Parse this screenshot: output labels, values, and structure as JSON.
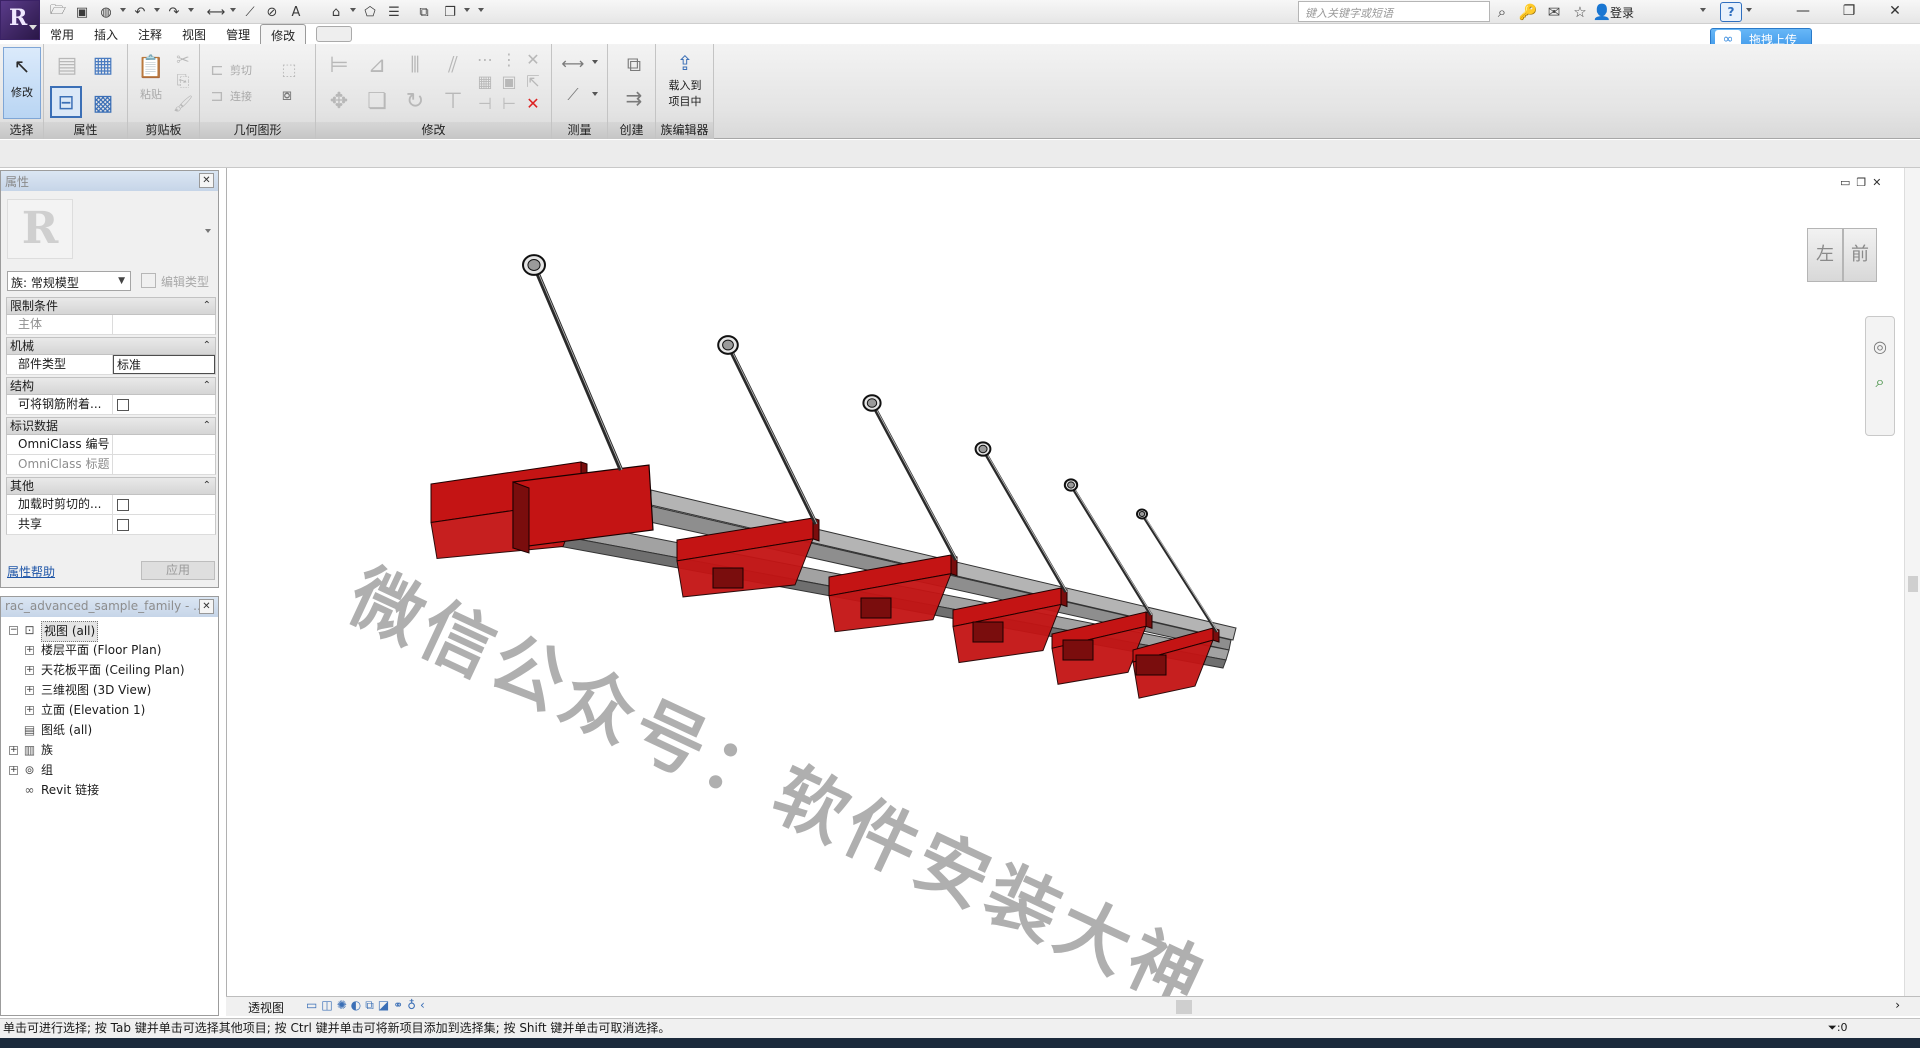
{
  "quick_access": {
    "icons": [
      "open-icon",
      "save-icon",
      "sync-icon",
      "undo-icon",
      "redo-icon",
      "measure-icon",
      "dimension-icon",
      "tag-icon",
      "text-icon",
      "3d-view-icon",
      "section-icon",
      "thin-lines-icon",
      "close-hidden-icon",
      "switch-windows-icon",
      "customize-icon"
    ]
  },
  "search": {
    "placeholder": "键入关键字或短语"
  },
  "user": {
    "login_label": "登录"
  },
  "tabs": [
    "常用",
    "插入",
    "注释",
    "视图",
    "管理",
    "修改"
  ],
  "active_tab": "修改",
  "ribbon": {
    "panels": {
      "select": "选择",
      "properties": "属性",
      "clipboard": "剪贴板",
      "geometry": "几何图形",
      "modify": "修改",
      "measure": "测量",
      "create": "创建",
      "family_editor": "族编辑器"
    },
    "buttons": {
      "modify": "修改",
      "paste": "粘贴",
      "cut": "剪切",
      "join": "连接",
      "load_line1": "载入到",
      "load_line2": "项目中"
    }
  },
  "baidu": {
    "upload_label": "拖拽上传"
  },
  "properties": {
    "title": "属性",
    "family_select": "族: 常规模型",
    "edit_type": "编辑类型",
    "groups": [
      {
        "name": "限制条件",
        "rows": [
          {
            "key": "主体",
            "value": "",
            "dim": true
          }
        ]
      },
      {
        "name": "机械",
        "rows": [
          {
            "key": "部件类型",
            "value": "标准",
            "boxed": true
          }
        ]
      },
      {
        "name": "结构",
        "rows": [
          {
            "key": "可将钢筋附着...",
            "checkbox": true
          }
        ]
      },
      {
        "name": "标识数据",
        "rows": [
          {
            "key": "OmniClass 编号",
            "value": ""
          },
          {
            "key": "OmniClass 标题",
            "value": "",
            "dim": true
          }
        ]
      },
      {
        "name": "其他",
        "rows": [
          {
            "key": "加载时剪切的...",
            "checkbox": true
          },
          {
            "key": "共享",
            "checkbox": true
          }
        ]
      }
    ],
    "help_link": "属性帮助",
    "apply": "应用"
  },
  "browser": {
    "title": "rac_advanced_sample_family - ...",
    "tree": [
      {
        "label": "视图 (all)",
        "level": 0,
        "expander": "−",
        "icon": "views-icon",
        "selected": true
      },
      {
        "label": "楼层平面 (Floor Plan)",
        "level": 1,
        "expander": "+"
      },
      {
        "label": "天花板平面 (Ceiling Plan)",
        "level": 1,
        "expander": "+"
      },
      {
        "label": "三维视图 (3D View)",
        "level": 1,
        "expander": "+"
      },
      {
        "label": "立面 (Elevation 1)",
        "level": 1,
        "expander": "+"
      },
      {
        "label": "图纸 (all)",
        "level": 0,
        "expander": "",
        "icon": "sheets-icon"
      },
      {
        "label": "族",
        "level": 0,
        "expander": "+",
        "icon": "families-icon"
      },
      {
        "label": "组",
        "level": 0,
        "expander": "+",
        "icon": "groups-icon"
      },
      {
        "label": "Revit 链接",
        "level": 0,
        "expander": "",
        "icon": "links-icon"
      }
    ]
  },
  "canvas": {
    "viewcube": {
      "left": "左",
      "front": "前"
    },
    "watermark": "微信公众号：软件安装大神",
    "colors": {
      "beam": "#c41414",
      "beam_dark": "#7a0d0d",
      "rail": "#9a9a9a",
      "rod": "#2a2a2a"
    }
  },
  "viewbar": {
    "label": "透视图"
  },
  "status": {
    "message": "单击可进行选择; 按 Tab 键并单击可选择其他项目; 按 Ctrl 键并单击可将新项目添加到选择集; 按 Shift 键并单击可取消选择。",
    "filter_count": ":0"
  }
}
